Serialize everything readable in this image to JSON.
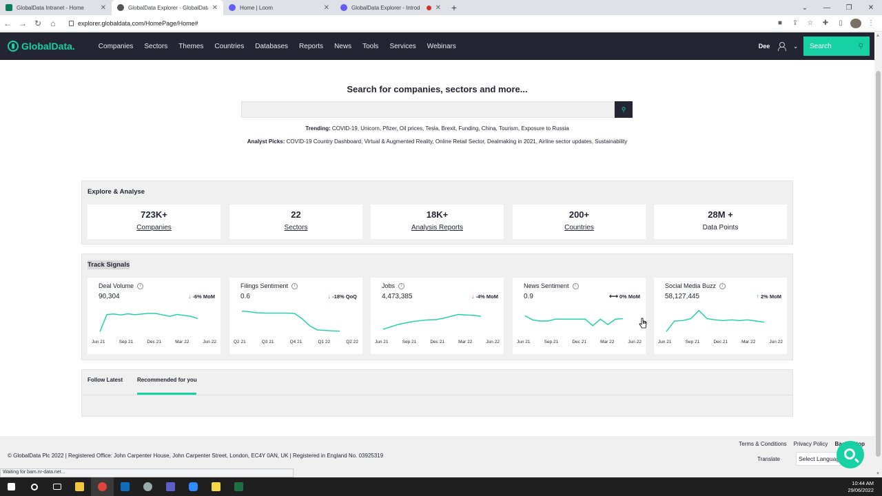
{
  "browser": {
    "tabs": [
      {
        "title": "GlobalData Intranet - Home",
        "icon_color": "#0a7d5c",
        "active": false
      },
      {
        "title": "GlobalData Explorer - GlobalData",
        "icon_color": "#555555",
        "active": true
      },
      {
        "title": "Home | Loom",
        "icon_color": "#625df5",
        "active": false
      },
      {
        "title": "GlobalData Explorer - Introd",
        "icon_color": "#625df5",
        "active": false
      }
    ],
    "url": "explorer.globaldata.com/HomePage/Home#",
    "status_text": "Waiting for bam.nr-data.net..."
  },
  "nav": {
    "logo": "GlobalData.",
    "menu": [
      "Companies",
      "Sectors",
      "Themes",
      "Countries",
      "Databases",
      "Reports",
      "News",
      "Tools",
      "Services",
      "Webinars"
    ],
    "user": "Dee",
    "search_label": "Search"
  },
  "hero": {
    "title": "Search for companies, sectors and more...",
    "trending_label": "Trending:",
    "trending": "COVID-19, Unicorn, Pfizer, Oil prices, Tesla, Brexit, Funding, China, Tourism, Exposure to Russia",
    "picks_label": "Analyst Picks:",
    "picks": "COVID-19 Country Dashboard, Virtual & Augmented Reality, Online Retail Sector, Dealmaking in 2021, Airline sector updates, Sustainability"
  },
  "explore": {
    "title": "Explore & Analyse",
    "stats": [
      {
        "value": "723K+",
        "label": "Companies"
      },
      {
        "value": "22",
        "label": "Sectors"
      },
      {
        "value": "18K+",
        "label": "Analysis Reports"
      },
      {
        "value": "200+",
        "label": "Countries"
      },
      {
        "value": "28M +",
        "label": "Data Points"
      }
    ]
  },
  "signals": {
    "title": "Track Signals",
    "cards": [
      {
        "title": "Deal Volume",
        "value": "90,304",
        "change": "-6% MoM",
        "direction": "down",
        "ticks": [
          "Jun 21",
          "Sep 21",
          "Dec 21",
          "Mar 22",
          "Jun 22"
        ],
        "series": [
          0.05,
          0.78,
          0.8,
          0.76,
          0.81,
          0.77,
          0.8,
          0.83,
          0.82,
          0.76,
          0.7,
          0.78,
          0.74,
          0.7,
          0.6
        ]
      },
      {
        "title": "Filings Sentiment",
        "value": "0.6",
        "change": "-18% QoQ",
        "direction": "down",
        "ticks": [
          "Q2 21",
          "Q3 21",
          "Q4 21",
          "Q1 22",
          "Q2 22"
        ],
        "series": [
          0.92,
          0.9,
          0.85,
          0.84,
          0.84,
          0.84,
          0.84,
          0.82,
          0.6,
          0.3,
          0.12,
          0.1,
          0.08,
          0.07
        ]
      },
      {
        "title": "Jobs",
        "value": "4,473,385",
        "change": "-4% MoM",
        "direction": "down",
        "ticks": [
          "Jun 21",
          "Sep 21",
          "Dec 21",
          "Mar 22",
          "Jun 22"
        ],
        "series": [
          0.15,
          0.25,
          0.35,
          0.42,
          0.48,
          0.52,
          0.55,
          0.56,
          0.62,
          0.7,
          0.78,
          0.76,
          0.74,
          0.7
        ]
      },
      {
        "title": "News Sentiment",
        "value": "0.9",
        "change": "0% MoM",
        "direction": "flat",
        "ticks": [
          "Jun 21",
          "Sep 21",
          "Dec 21",
          "Mar 22",
          "Jun 22"
        ],
        "series": [
          0.72,
          0.55,
          0.5,
          0.5,
          0.58,
          0.58,
          0.58,
          0.58,
          0.58,
          0.3,
          0.58,
          0.35,
          0.58,
          0.6
        ]
      },
      {
        "title": "Social Media Buzz",
        "value": "58,127,445",
        "change": "2% MoM",
        "direction": "up",
        "ticks": [
          "Jun 21",
          "Sep 21",
          "Dec 21",
          "Mar 22",
          "Jun 22"
        ],
        "series": [
          0.05,
          0.5,
          0.52,
          0.6,
          0.95,
          0.6,
          0.55,
          0.52,
          0.55,
          0.52,
          0.55,
          0.5,
          0.45
        ]
      }
    ]
  },
  "follow": {
    "tabs": [
      "Follow Latest",
      "Recommended for you"
    ]
  },
  "footer": {
    "links": [
      "Terms & Conditions",
      "Privacy Policy",
      "Back to top"
    ],
    "copyright": "© GlobalData Plc 2022 | Registered Office: John Carpenter House, John Carpenter Street, London, EC4Y 0AN, UK | Registered in England No. 03925319",
    "translate_label": "Translate",
    "language_select": "Select Language"
  },
  "taskbar": {
    "time": "10:44 AM",
    "date": "29/06/2022"
  },
  "colors": {
    "accent": "#16d1a4",
    "nav_bg": "#232533"
  }
}
